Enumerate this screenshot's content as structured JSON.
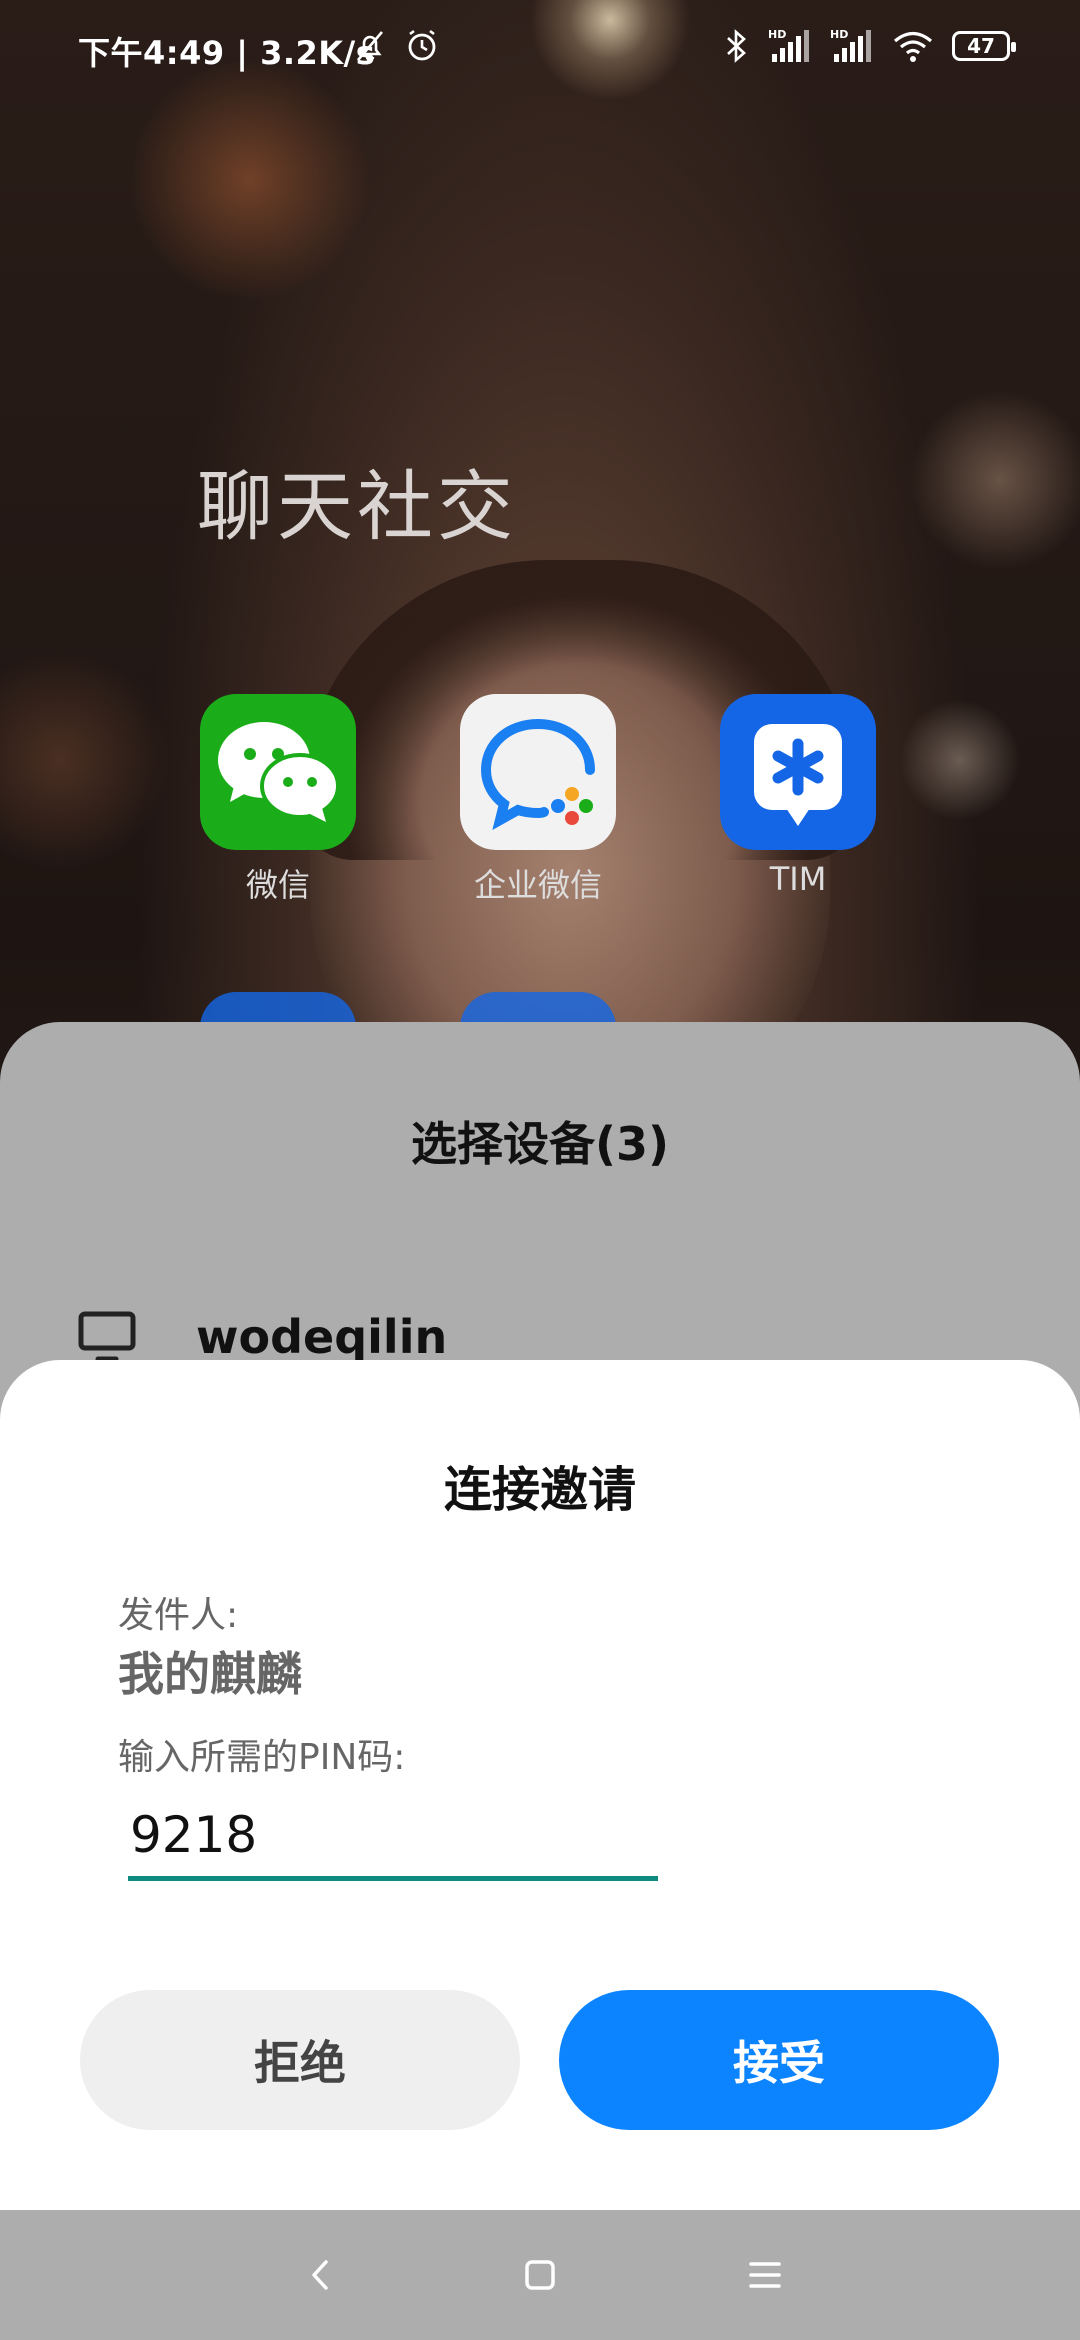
{
  "status_bar": {
    "time_and_speed": "下午4:49 | 3.2K/s",
    "battery": "47"
  },
  "home": {
    "folder_title": "聊天社交",
    "apps": [
      {
        "label": "微信",
        "icon": "wechat-icon",
        "color": "#1aad19"
      },
      {
        "label": "企业微信",
        "icon": "wecom-icon",
        "color": "#f2f2f2"
      },
      {
        "label": "TIM",
        "icon": "tim-icon",
        "color": "#1466e6"
      }
    ]
  },
  "device_sheet": {
    "title": "选择设备(3)",
    "devices": [
      {
        "name": "wodeqilin",
        "icon": "monitor-icon"
      }
    ]
  },
  "dialog": {
    "title": "连接邀请",
    "sender_label": "发件人:",
    "sender_name": "我的麒麟",
    "pin_label": "输入所需的PIN码:",
    "pin_value": "9218",
    "reject_label": "拒绝",
    "accept_label": "接受",
    "accent_color": "#0d84ff",
    "underline_color": "#0f8a7e"
  },
  "nav_bar": {
    "buttons": [
      "back-icon",
      "home-icon",
      "menu-icon"
    ]
  }
}
